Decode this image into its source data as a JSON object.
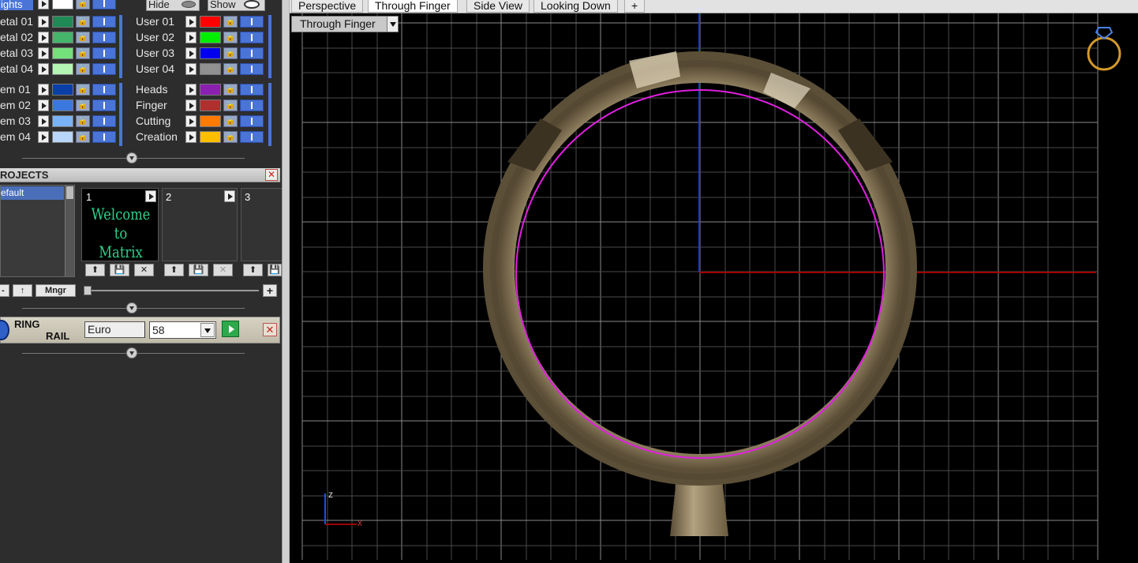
{
  "layers": {
    "header": {
      "label": "ights",
      "hide_label": "Hide",
      "show_label": "Show"
    },
    "left_col": [
      {
        "label": "etal 01",
        "color": "#1f8a55"
      },
      {
        "label": "etal 02",
        "color": "#44b56a"
      },
      {
        "label": "etal 03",
        "color": "#74e07c"
      },
      {
        "label": "etal 04",
        "color": "#b4f5b4"
      },
      {
        "label": "em 01",
        "color": "#0a3fa8"
      },
      {
        "label": "em 02",
        "color": "#3a78e0"
      },
      {
        "label": "em 03",
        "color": "#7ab3f5"
      },
      {
        "label": "em 04",
        "color": "#b8d6f8"
      }
    ],
    "right_col": [
      {
        "label": "User 01",
        "color": "#ff0000"
      },
      {
        "label": "User 02",
        "color": "#00ee00"
      },
      {
        "label": "User 03",
        "color": "#0000ee"
      },
      {
        "label": "User 04",
        "color": "#909090"
      },
      {
        "label": "Heads",
        "color": "#8a1fb0"
      },
      {
        "label": "Finger",
        "color": "#b03030"
      },
      {
        "label": "Cutting",
        "color": "#ff7a00"
      },
      {
        "label": "Creation",
        "color": "#ffbf00"
      }
    ]
  },
  "projects": {
    "title": "ROJECTS",
    "list_item": "efault",
    "slots": [
      {
        "number": "1",
        "thumb_text": "Welcome to Matrix"
      },
      {
        "number": "2"
      },
      {
        "number": "3"
      }
    ],
    "mngr_label": "Mngr",
    "up_label": "↑",
    "minus_label": "-",
    "plus_label": "+"
  },
  "ring_rail": {
    "line1": "RING",
    "line2": "RAIL",
    "unit": "Euro",
    "size": "58"
  },
  "viewport": {
    "tabs": [
      "Perspective",
      "Through Finger",
      "Side View",
      "Looking Down"
    ],
    "active_tab": 1,
    "add_tab": "+",
    "view_dropdown": "Through Finger",
    "axis_z": "z",
    "axis_x": "x"
  }
}
